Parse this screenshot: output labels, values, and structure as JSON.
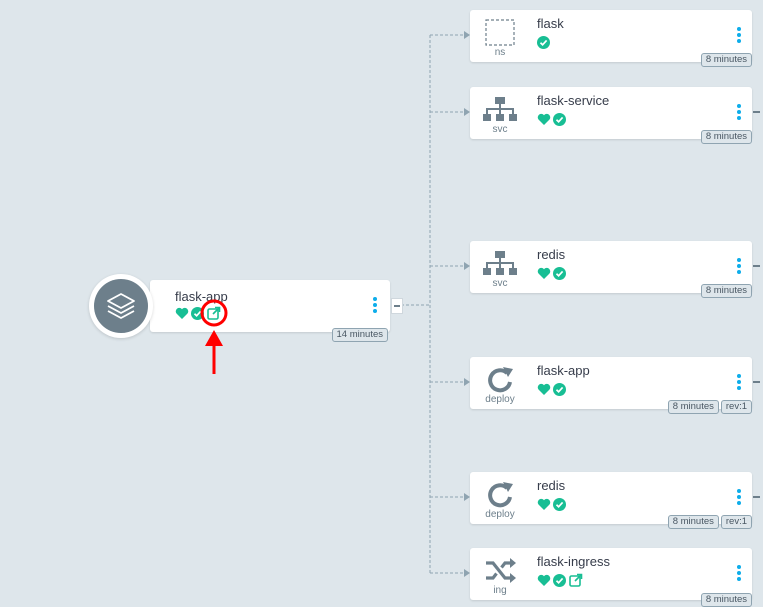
{
  "app": {
    "name": "flask-app",
    "age": "14 minutes",
    "status_icons": [
      "heart-icon",
      "check-circle-icon",
      "external-link-icon"
    ]
  },
  "resources": [
    {
      "name": "flask",
      "kind": "ns",
      "icon": "namespace-icon",
      "status_icons": [
        "check-circle-icon"
      ],
      "age": "8 minutes"
    },
    {
      "name": "flask-service",
      "kind": "svc",
      "icon": "service-icon",
      "status_icons": [
        "heart-icon",
        "check-circle-icon"
      ],
      "age": "8 minutes"
    },
    {
      "name": "redis",
      "kind": "svc",
      "icon": "service-icon",
      "status_icons": [
        "heart-icon",
        "check-circle-icon"
      ],
      "age": "8 minutes"
    },
    {
      "name": "flask-app",
      "kind": "deploy",
      "icon": "deploy-icon",
      "status_icons": [
        "heart-icon",
        "check-circle-icon"
      ],
      "age": "8 minutes",
      "revision": "rev:1"
    },
    {
      "name": "redis",
      "kind": "deploy",
      "icon": "deploy-icon",
      "status_icons": [
        "heart-icon",
        "check-circle-icon"
      ],
      "age": "8 minutes",
      "revision": "rev:1"
    },
    {
      "name": "flask-ingress",
      "kind": "ing",
      "icon": "ingress-icon",
      "status_icons": [
        "heart-icon",
        "check-circle-icon",
        "external-link-icon"
      ],
      "age": "8 minutes"
    }
  ],
  "colors": {
    "healthy": "#18be94",
    "annotation": "#ff0000",
    "menu": "#0dadea",
    "background": "#dee6eb"
  }
}
